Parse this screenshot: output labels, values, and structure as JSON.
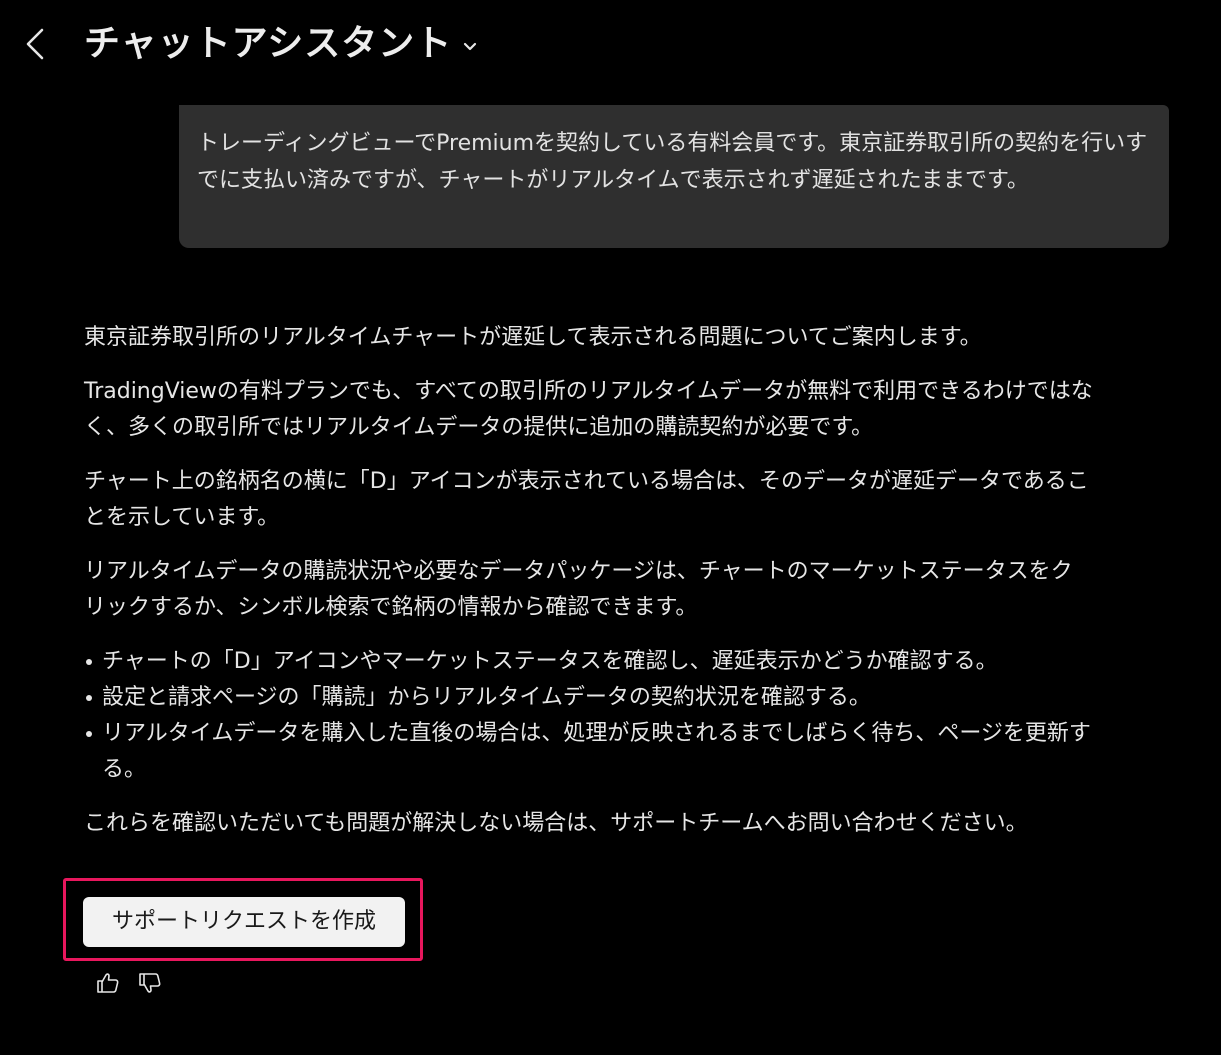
{
  "header": {
    "title": "チャットアシスタント",
    "back_icon": "chevron-left-icon",
    "dropdown_icon": "chevron-down-icon"
  },
  "user_message": "トレーディングビューでPremiumを契約している有料会員です。東京証券取引所の契約を行いすでに支払い済みですが、チャートがリアルタイムで表示されず遅延されたままです。",
  "assistant": {
    "paragraphs": [
      "東京証券取引所のリアルタイムチャートが遅延して表示される問題についてご案内します。",
      "TradingViewの有料プランでも、すべての取引所のリアルタイムデータが無料で利用できるわけではなく、多くの取引所ではリアルタイムデータの提供に追加の購読契約が必要です。",
      "チャート上の銘柄名の横に「D」アイコンが表示されている場合は、そのデータが遅延データであることを示しています。",
      "リアルタイムデータの購読状況や必要なデータパッケージは、チャートのマーケットステータスをクリックするか、シンボル検索で銘柄の情報から確認できます。"
    ],
    "bullets": [
      "チャートの「D」アイコンやマーケットステータスを確認し、遅延表示かどうか確認する。",
      "設定と請求ページの「購読」からリアルタイムデータの契約状況を確認する。",
      "リアルタイムデータを購入した直後の場合は、処理が反映されるまでしばらく待ち、ページを更新する。"
    ],
    "closing": "これらを確認いただいても問題が解決しない場合は、サポートチームへお問い合わせください。"
  },
  "support_button_label": "サポートリクエストを作成",
  "feedback": {
    "like_icon": "thumbs-up-icon",
    "dislike_icon": "thumbs-down-icon"
  },
  "colors": {
    "background": "#000000",
    "bubble": "#2f2f2f",
    "text": "#e6e6e6",
    "button_bg": "#f2f2f2",
    "highlight": "#e8175d"
  }
}
